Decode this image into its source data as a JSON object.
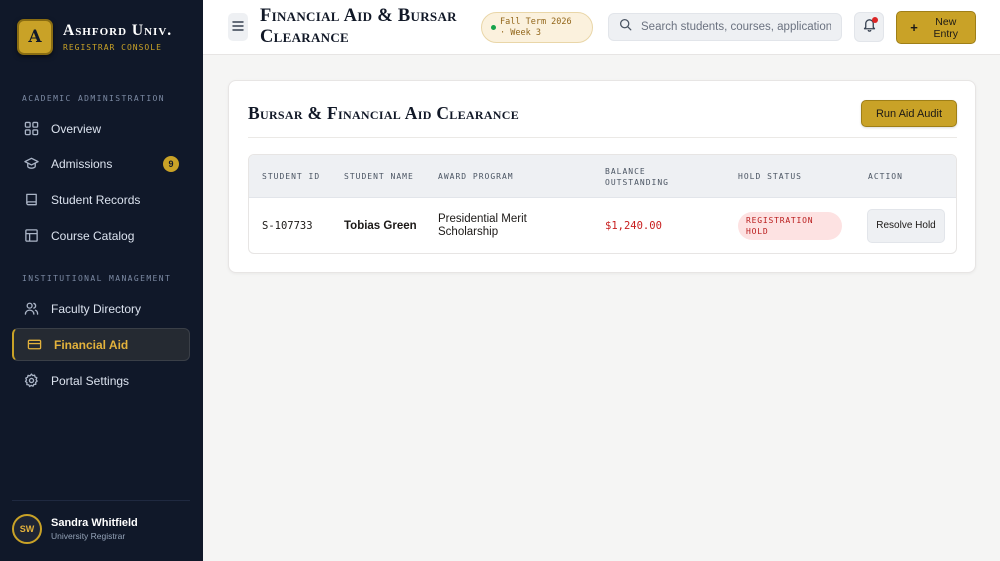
{
  "brand": {
    "logo_letter": "A",
    "name": "Ashford Univ.",
    "subtitle": "REGISTRAR CONSOLE"
  },
  "sidebar": {
    "sections": [
      {
        "label": "ACADEMIC ADMINISTRATION"
      },
      {
        "label": "INSTITUTIONAL MANAGEMENT"
      }
    ],
    "items": [
      {
        "label": "Overview",
        "icon": "grid-icon"
      },
      {
        "label": "Admissions",
        "icon": "graduation-cap-icon",
        "badge": "9"
      },
      {
        "label": "Student Records",
        "icon": "book-icon"
      },
      {
        "label": "Course Catalog",
        "icon": "layout-icon"
      },
      {
        "label": "Faculty Directory",
        "icon": "users-icon"
      },
      {
        "label": "Financial Aid",
        "icon": "credit-card-icon",
        "active": true
      },
      {
        "label": "Portal Settings",
        "icon": "gear-icon"
      }
    ],
    "user": {
      "initials": "SW",
      "name": "Sandra Whitfield",
      "role": "University Registrar"
    }
  },
  "header": {
    "title": "Financial Aid & Bursar Clearance",
    "term_line1": "Fall Term 2026",
    "term_line2": "· Week 3",
    "search_placeholder": "Search students, courses, applications...",
    "new_button_label": "New Entry"
  },
  "main": {
    "card_title": "Bursar & Financial Aid Clearance",
    "audit_button_label": "Run Aid Audit",
    "table": {
      "columns": [
        "STUDENT ID",
        "STUDENT NAME",
        "AWARD PROGRAM",
        "BALANCE OUTSTANDING",
        "HOLD STATUS",
        "ACTION"
      ],
      "rows": [
        {
          "student_id": "S-107733",
          "student_name": "Tobias Green",
          "award_program": "Presidential Merit Scholarship",
          "balance": "$1,240.00",
          "hold_status": "REGISTRATION HOLD",
          "action": "Resolve Hold"
        }
      ]
    }
  },
  "colors": {
    "accent_gold": "#c9a227",
    "sidebar_bg": "#101829",
    "danger": "#c81e1e"
  }
}
